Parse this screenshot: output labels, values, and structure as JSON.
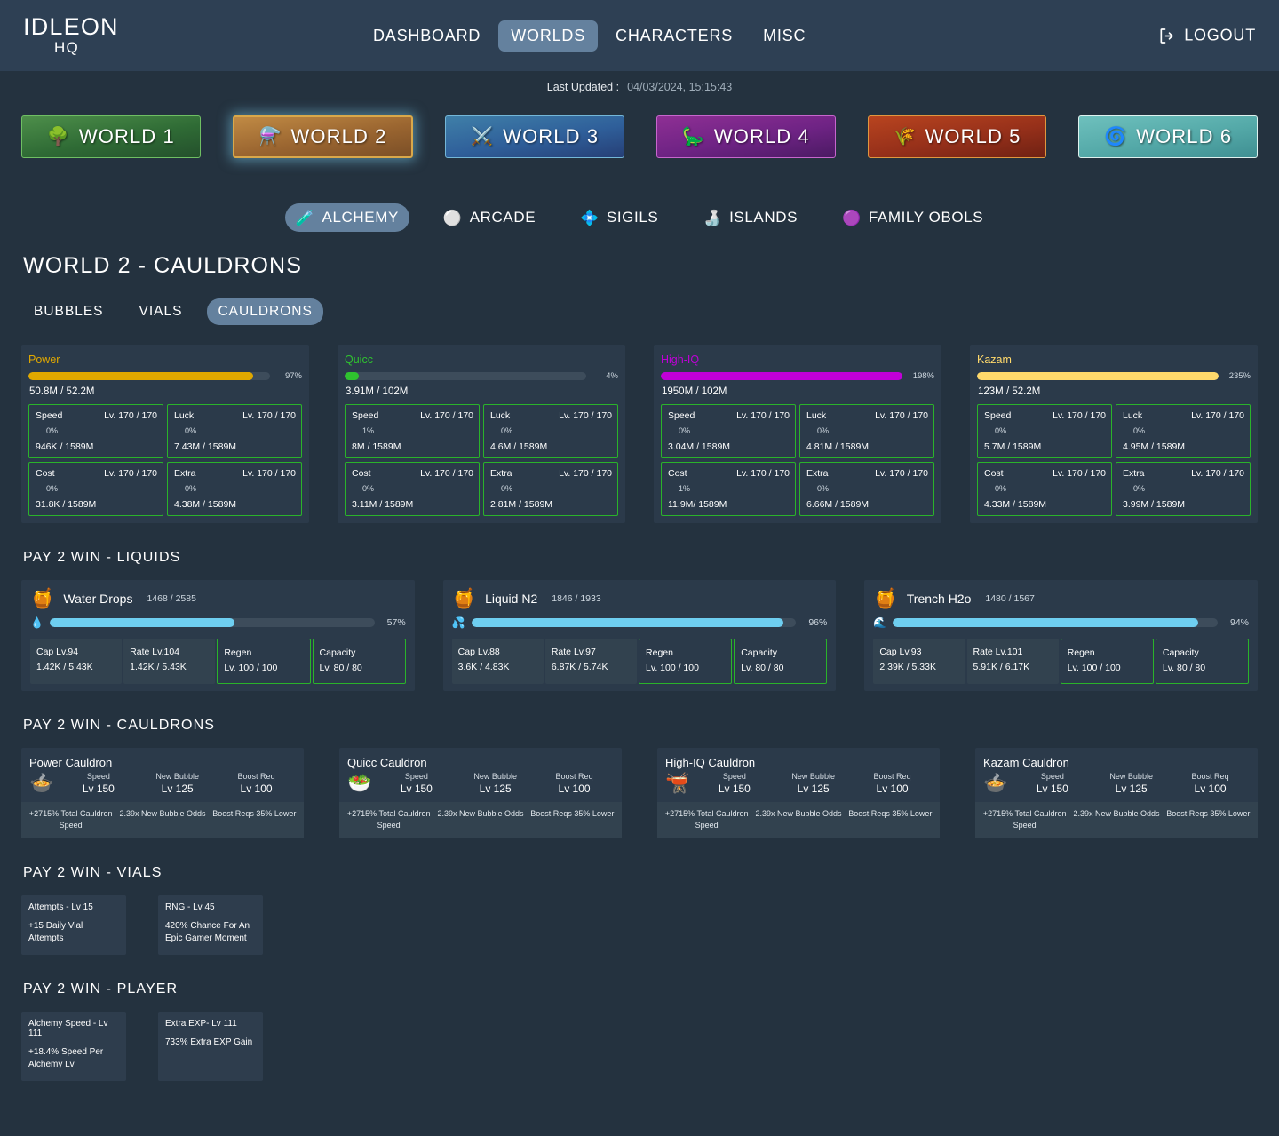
{
  "header": {
    "brand_main": "IDLEON",
    "brand_sub": "HQ",
    "nav": [
      {
        "label": "DASHBOARD",
        "active": false
      },
      {
        "label": "WORLDS",
        "active": true
      },
      {
        "label": "CHARACTERS",
        "active": false
      },
      {
        "label": "MISC",
        "active": false
      }
    ],
    "logout_label": "LOGOUT",
    "logout_icon": "logout-arrow-icon",
    "updated_label": "Last Updated :",
    "updated_value": "04/03/2024, 15:15:43"
  },
  "worlds": [
    {
      "label": "WORLD 1",
      "icon": "🌳",
      "cls": "w1",
      "selected": false
    },
    {
      "label": "WORLD 2",
      "icon": "⚗️",
      "cls": "w2",
      "selected": true
    },
    {
      "label": "WORLD 3",
      "icon": "⚔️",
      "cls": "w3",
      "selected": false
    },
    {
      "label": "WORLD 4",
      "icon": "🦕",
      "cls": "w4",
      "selected": false
    },
    {
      "label": "WORLD 5",
      "icon": "🌾",
      "cls": "w5",
      "selected": false
    },
    {
      "label": "WORLD 6",
      "icon": "🌀",
      "cls": "w6",
      "selected": false
    }
  ],
  "subnav": [
    {
      "label": "ALCHEMY",
      "icon": "🧪",
      "active": true
    },
    {
      "label": "ARCADE",
      "icon": "⚪",
      "active": false
    },
    {
      "label": "SIGILS",
      "icon": "💠",
      "active": false
    },
    {
      "label": "ISLANDS",
      "icon": "🍶",
      "active": false
    },
    {
      "label": "FAMILY OBOLS",
      "icon": "🟣",
      "active": false
    }
  ],
  "page_title": "WORLD 2 - CAULDRONS",
  "tabs": [
    {
      "label": "BUBBLES",
      "active": false
    },
    {
      "label": "VIALS",
      "active": false
    },
    {
      "label": "CAULDRONS",
      "active": true
    }
  ],
  "cauldrons": [
    {
      "name": "Power",
      "color": "#e0a800",
      "percent": "97%",
      "fill": 93,
      "amount": "50.8M / 52.2M",
      "stats": [
        {
          "name": "Speed",
          "level": "Lv. 170 / 170",
          "percent": "0%",
          "fill": 4,
          "amount": "946K / 1589M"
        },
        {
          "name": "Luck",
          "level": "Lv. 170 / 170",
          "percent": "0%",
          "fill": 4,
          "amount": "7.43M / 1589M"
        },
        {
          "name": "Cost",
          "level": "Lv. 170 / 170",
          "percent": "0%",
          "fill": 4,
          "amount": "31.8K / 1589M"
        },
        {
          "name": "Extra",
          "level": "Lv. 170 / 170",
          "percent": "0%",
          "fill": 4,
          "amount": "4.38M / 1589M"
        }
      ]
    },
    {
      "name": "Quicc",
      "color": "#2fc22f",
      "percent": "4%",
      "fill": 6,
      "amount": "3.91M / 102M",
      "stats": [
        {
          "name": "Speed",
          "level": "Lv. 170 / 170",
          "percent": "1%",
          "fill": 4,
          "amount": "8M / 1589M"
        },
        {
          "name": "Luck",
          "level": "Lv. 170 / 170",
          "percent": "0%",
          "fill": 4,
          "amount": "4.6M / 1589M"
        },
        {
          "name": "Cost",
          "level": "Lv. 170 / 170",
          "percent": "0%",
          "fill": 4,
          "amount": "3.11M / 1589M"
        },
        {
          "name": "Extra",
          "level": "Lv. 170 / 170",
          "percent": "0%",
          "fill": 4,
          "amount": "2.81M / 1589M"
        }
      ]
    },
    {
      "name": "High-IQ",
      "color": "#c000d8",
      "percent": "198%",
      "fill": 100,
      "amount": "1950M / 102M",
      "stats": [
        {
          "name": "Speed",
          "level": "Lv. 170 / 170",
          "percent": "0%",
          "fill": 4,
          "amount": "3.04M / 1589M"
        },
        {
          "name": "Luck",
          "level": "Lv. 170 / 170",
          "percent": "0%",
          "fill": 4,
          "amount": "4.81M / 1589M"
        },
        {
          "name": "Cost",
          "level": "Lv. 170 / 170",
          "percent": "1%",
          "fill": 5,
          "amount": "11.9M/ 1589M"
        },
        {
          "name": "Extra",
          "level": "Lv. 170 / 170",
          "percent": "0%",
          "fill": 5,
          "amount": "6.66M / 1589M"
        }
      ]
    },
    {
      "name": "Kazam",
      "color": "#ffd96b",
      "percent": "235%",
      "fill": 100,
      "amount": "123M / 52.2M",
      "stats": [
        {
          "name": "Speed",
          "level": "Lv. 170 / 170",
          "percent": "0%",
          "fill": 4,
          "amount": "5.7M / 1589M"
        },
        {
          "name": "Luck",
          "level": "Lv. 170 / 170",
          "percent": "0%",
          "fill": 4,
          "amount": "4.95M / 1589M"
        },
        {
          "name": "Cost",
          "level": "Lv. 170 / 170",
          "percent": "0%",
          "fill": 4,
          "amount": "4.33M / 1589M"
        },
        {
          "name": "Extra",
          "level": "Lv. 170 / 170",
          "percent": "0%",
          "fill": 4,
          "amount": "3.99M / 1589M"
        }
      ]
    }
  ],
  "sections": {
    "liquids_heading": "PAY 2 WIN - LIQUIDS",
    "cauldrons_heading": "PAY 2 WIN - CAULDRONS",
    "vials_heading": "PAY 2 WIN - VIALS",
    "player_heading": "PAY 2 WIN - PLAYER"
  },
  "liquids": [
    {
      "name": "Water Drops",
      "count": "1468 / 2585",
      "icon": "🍯",
      "bar_icon": "💧",
      "percent": "57%",
      "fill": 57,
      "stats": [
        {
          "title": "Cap Lv.94",
          "value": "1.42K / 5.43K",
          "bordered": false
        },
        {
          "title": "Rate Lv.104",
          "value": "1.42K / 5.43K",
          "bordered": false
        },
        {
          "title": "Regen",
          "value": "Lv. 100 / 100",
          "bordered": true
        },
        {
          "title": "Capacity",
          "value": "Lv. 80 / 80",
          "bordered": true
        }
      ]
    },
    {
      "name": "Liquid N2",
      "count": "1846 / 1933",
      "icon": "🍯",
      "bar_icon": "💦",
      "percent": "96%",
      "fill": 96,
      "stats": [
        {
          "title": "Cap Lv.88",
          "value": "3.6K / 4.83K",
          "bordered": false
        },
        {
          "title": "Rate Lv.97",
          "value": "6.87K / 5.74K",
          "bordered": false
        },
        {
          "title": "Regen",
          "value": "Lv. 100 / 100",
          "bordered": true
        },
        {
          "title": "Capacity",
          "value": "Lv. 80 / 80",
          "bordered": true
        }
      ]
    },
    {
      "name": "Trench H2o",
      "count": "1480 / 1567",
      "icon": "🍯",
      "bar_icon": "🌊",
      "percent": "94%",
      "fill": 94,
      "stats": [
        {
          "title": "Cap Lv.93",
          "value": "2.39K / 5.33K",
          "bordered": false
        },
        {
          "title": "Rate Lv.101",
          "value": "5.91K / 6.17K",
          "bordered": false
        },
        {
          "title": "Regen",
          "value": "Lv. 100 / 100",
          "bordered": true
        },
        {
          "title": "Capacity",
          "value": "Lv. 80 / 80",
          "bordered": true
        }
      ]
    }
  ],
  "p2w_cauldrons": [
    {
      "title": "Power Cauldron",
      "icon": "🍲",
      "cols": [
        {
          "key": "Speed",
          "value": "Lv 150"
        },
        {
          "key": "New Bubble",
          "value": "Lv 125"
        },
        {
          "key": "Boost Req",
          "value": "Lv 100"
        }
      ],
      "foot": [
        "+2715% Total Cauldron Speed",
        "2.39x New Bubble Odds",
        "Boost Reqs 35% Lower"
      ]
    },
    {
      "title": "Quicc Cauldron",
      "icon": "🥗",
      "cols": [
        {
          "key": "Speed",
          "value": "Lv 150"
        },
        {
          "key": "New Bubble",
          "value": "Lv 125"
        },
        {
          "key": "Boost Req",
          "value": "Lv 100"
        }
      ],
      "foot": [
        "+2715% Total Cauldron Speed",
        "2.39x New Bubble Odds",
        "Boost Reqs 35% Lower"
      ]
    },
    {
      "title": "High-IQ Cauldron",
      "icon": "🫕",
      "cols": [
        {
          "key": "Speed",
          "value": "Lv 150"
        },
        {
          "key": "New Bubble",
          "value": "Lv 125"
        },
        {
          "key": "Boost Req",
          "value": "Lv 100"
        }
      ],
      "foot": [
        "+2715% Total Cauldron Speed",
        "2.39x New Bubble Odds",
        "Boost Reqs 35% Lower"
      ]
    },
    {
      "title": "Kazam Cauldron",
      "icon": "🍲",
      "cols": [
        {
          "key": "Speed",
          "value": "Lv 150"
        },
        {
          "key": "New Bubble",
          "value": "Lv 125"
        },
        {
          "key": "Boost Req",
          "value": "Lv 100"
        }
      ],
      "foot": [
        "+2715% Total Cauldron Speed",
        "2.39x New Bubble Odds",
        "Boost Reqs 35% Lower"
      ]
    }
  ],
  "p2w_vials": [
    {
      "title": "Attempts - Lv 15",
      "desc": "+15 Daily Vial Attempts"
    },
    {
      "title": "RNG - Lv 45",
      "desc": "420% Chance For An Epic Gamer Moment"
    }
  ],
  "p2w_player": [
    {
      "title": "Alchemy Speed - Lv 111",
      "desc": "+18.4% Speed Per Alchemy Lv"
    },
    {
      "title": "Extra EXP- Lv 111",
      "desc": "733% Extra EXP Gain"
    }
  ]
}
